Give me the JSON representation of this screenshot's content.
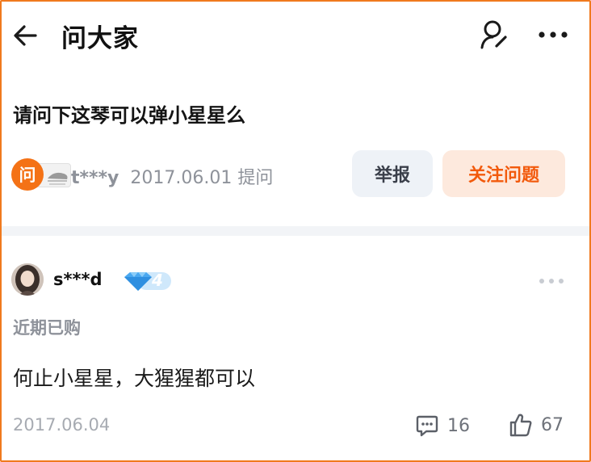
{
  "header": {
    "title": "问大家"
  },
  "question": {
    "text": "请问下这琴可以弹小星星么",
    "asker_avatar_char": "问",
    "asker_name": "t***y",
    "asked_date_label": "2017.06.01 提问",
    "report_label": "举报",
    "follow_label": "关注问题"
  },
  "answer": {
    "user_name": "s***d",
    "level": "4",
    "purchase_tag": "近期已购",
    "text": "何止小星星，大猩猩都可以",
    "date": "2017.06.04",
    "comment_count": "16",
    "like_count": "67"
  },
  "colors": {
    "accent": "#f25a0c",
    "frame": "#f07a1e",
    "secondary_text": "#8e929a",
    "level_badge": "#4aa8f0"
  },
  "icons": [
    "back-arrow-icon",
    "user-search-icon",
    "more-dots-icon",
    "diamond-icon",
    "comment-icon",
    "thumbs-up-icon"
  ]
}
